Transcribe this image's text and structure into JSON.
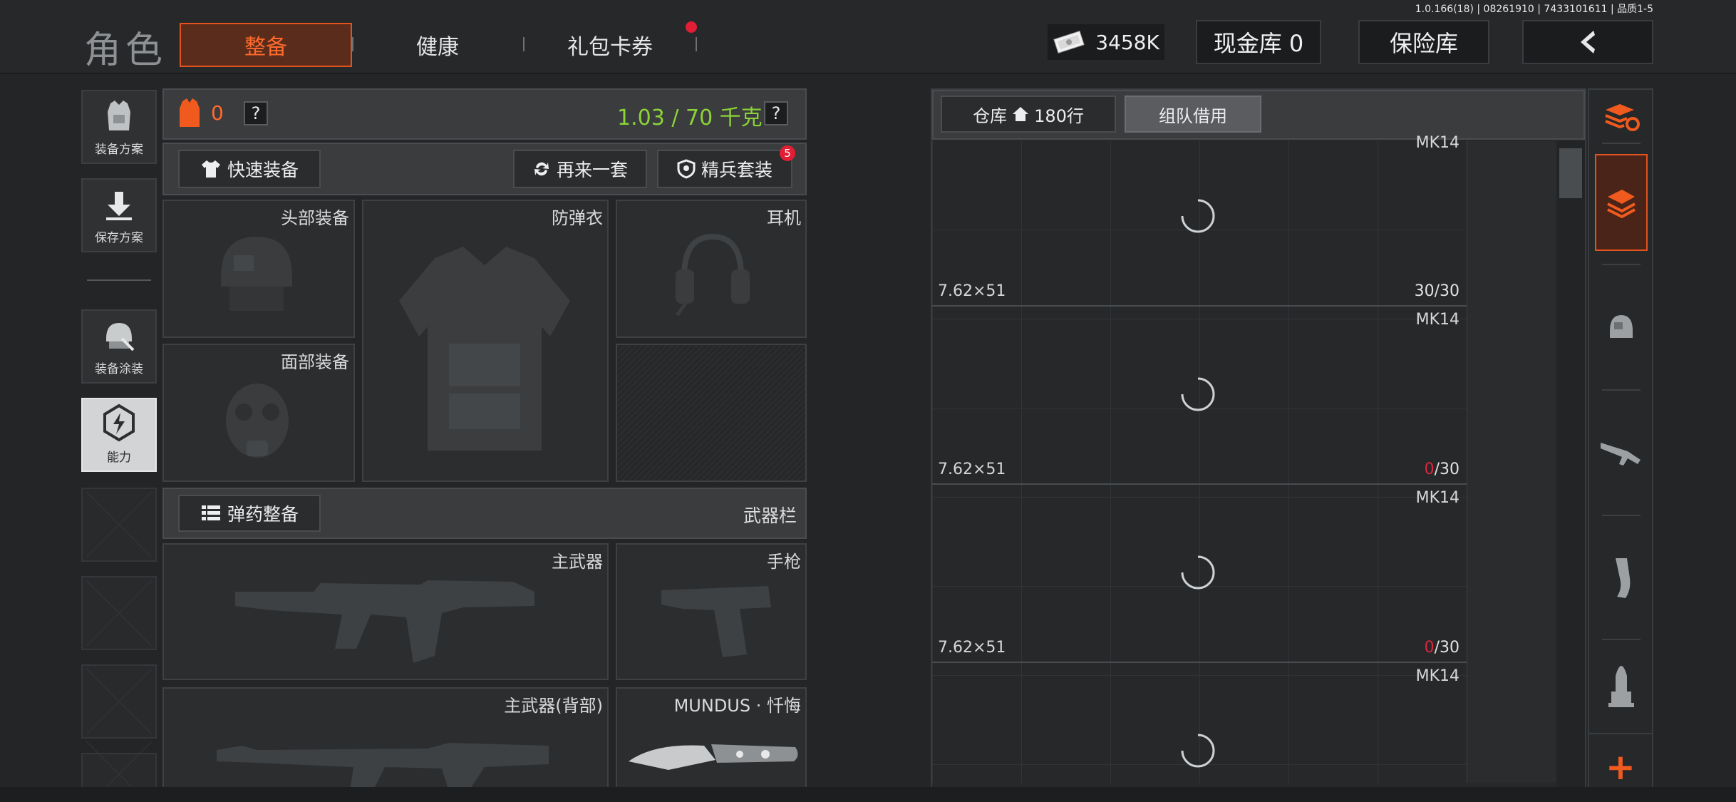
{
  "version_text": "1.0.166(18) | 08261910 | 7433101611 | 品质1-5",
  "header": {
    "title": "角色",
    "tabs": [
      {
        "label": "整备",
        "active": true
      },
      {
        "label": "健康",
        "active": false
      },
      {
        "label": "礼包卡券",
        "active": false,
        "badge_dot": true
      }
    ],
    "money": "3458K",
    "cash_label": "现金库 0",
    "safe_label": "保险库",
    "back_icon": "back-arrow-icon"
  },
  "sidebar": {
    "items": [
      {
        "label": "装备方案",
        "icon": "vest-icon"
      },
      {
        "label": "保存方案",
        "icon": "download-icon"
      },
      {
        "label": "装备涂装",
        "icon": "helmet-paint-icon"
      },
      {
        "label": "能力",
        "icon": "ability-icon",
        "selected": true
      }
    ]
  },
  "loadout": {
    "armor_count": "0",
    "help": "?",
    "weight": "1.03 / 70 千克",
    "quick_equip": "快速装备",
    "again_set": "再来一套",
    "elite_set": "精兵套装",
    "elite_badge": "5",
    "slots": {
      "head": "头部装备",
      "vest": "防弹衣",
      "ear": "耳机",
      "face": "面部装备"
    },
    "ammo_button": "弹药整备",
    "weapon_bar": "武器栏",
    "weapons": {
      "primary": "主武器",
      "pistol": "手枪",
      "primary_back": "主武器(背部)",
      "melee": "MUNDUS · 忏悔"
    }
  },
  "storage": {
    "tab_label": "仓库",
    "rows": "180行",
    "team_borrow": "组队借用",
    "items": [
      {
        "name": "MK14",
        "ammo": "7.62×51",
        "count_current": "30",
        "count_max": "/30",
        "empty": false
      },
      {
        "name": "MK14",
        "ammo": "7.62×51",
        "count_current": "0",
        "count_max": "/30",
        "empty": true
      },
      {
        "name": "MK14",
        "ammo": "7.62×51",
        "count_current": "0",
        "count_max": "/30",
        "empty": true
      },
      {
        "name": "MK14",
        "ammo": "",
        "count_current": "",
        "count_max": "",
        "empty": false
      }
    ]
  },
  "right_rail": {
    "icons": [
      "sort-refresh-icon",
      "all-items-icon",
      "armor-filter-icon",
      "rifle-filter-icon",
      "magazine-filter-icon",
      "ammo-filter-icon"
    ],
    "add_label": "+"
  },
  "colors": {
    "accent": "#e2531f",
    "weight_green": "#8bd337",
    "alert_red": "#e0253e"
  }
}
